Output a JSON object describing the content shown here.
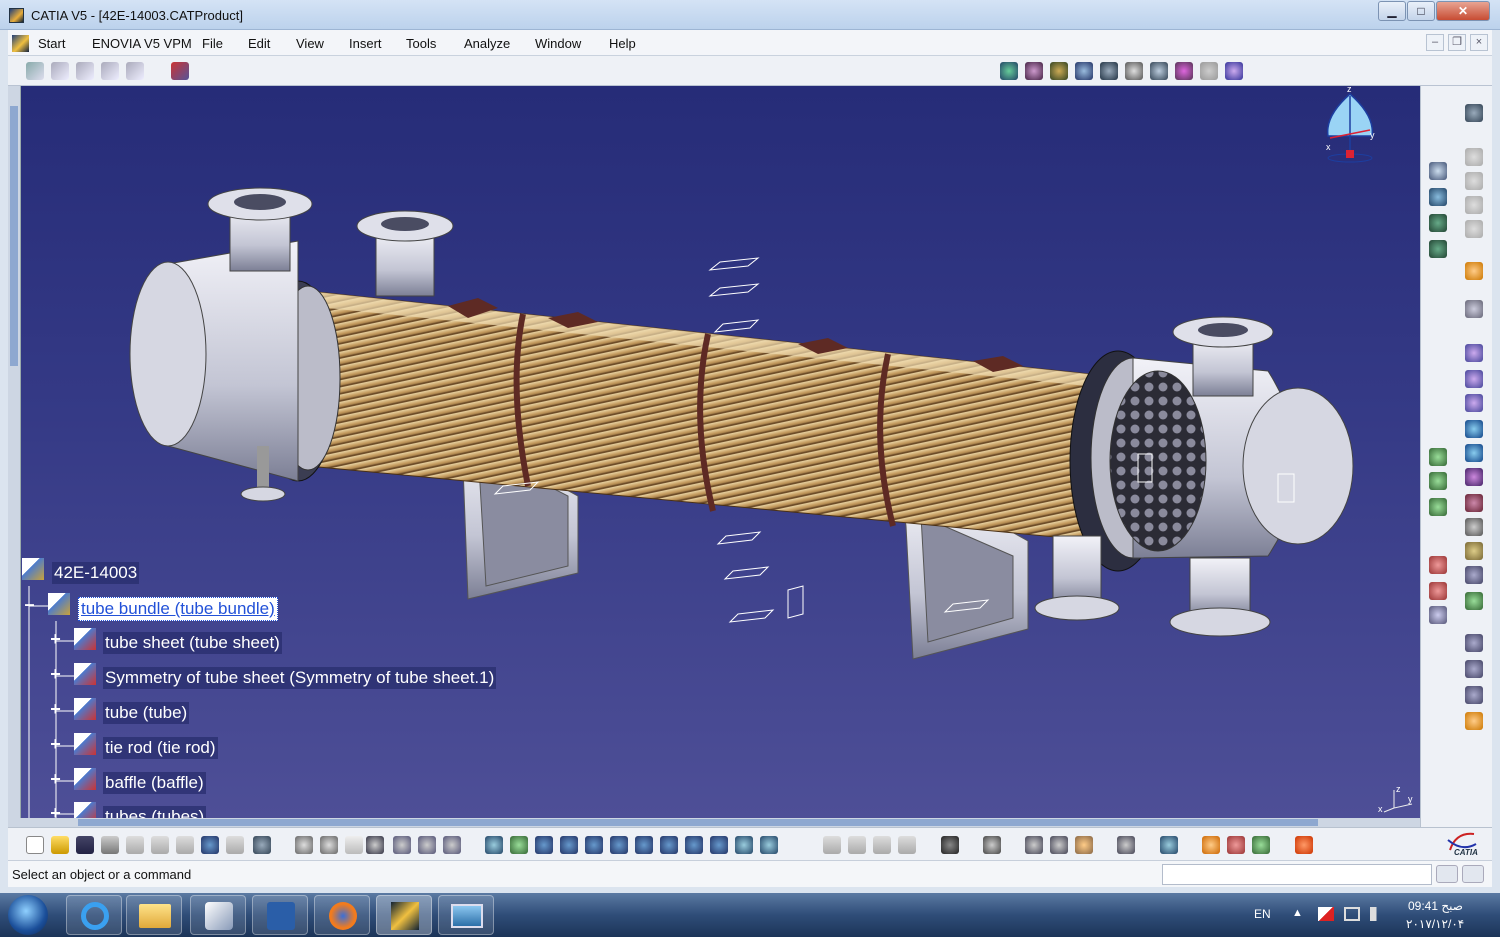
{
  "window": {
    "title": "CATIA V5 - [42E-14003.CATProduct]",
    "minimize": "▁",
    "maximize": "□",
    "close": "✕"
  },
  "menubar": {
    "items": [
      "Start",
      "ENOVIA V5 VPM",
      "File",
      "Edit",
      "View",
      "Insert",
      "Tools",
      "Analyze",
      "Window",
      "Help"
    ],
    "mdi_minimize": "–",
    "mdi_restore": "❐",
    "mdi_close": "×"
  },
  "tree": {
    "root": "42E-14003",
    "selected": "tube bundle (tube bundle)",
    "children": [
      "tube sheet (tube sheet)",
      "Symmetry of tube sheet (Symmetry of tube sheet.1)",
      "tube (tube)",
      "tie rod (tie rod)",
      "baffle (baffle)",
      "tubes (tubes)"
    ]
  },
  "compass": {
    "z": "z",
    "x": "x",
    "y": "y"
  },
  "axis_triad": {
    "z": "z",
    "x": "x",
    "y": "y"
  },
  "brand": "CATIA",
  "status": {
    "text": "Select an object or a command"
  },
  "taskbar": {
    "lang": "EN",
    "time": "09:41 صبح",
    "date": "۲۰۱۷/۱۲/۰۴"
  },
  "colors": {
    "viewport_top": "#262c78",
    "viewport_bottom": "#4e4f97",
    "tree_selection": "#2251d8",
    "tubes": "#c9a36a",
    "baffle": "#5e2a24",
    "shell_metal": "#c9cbd8"
  }
}
